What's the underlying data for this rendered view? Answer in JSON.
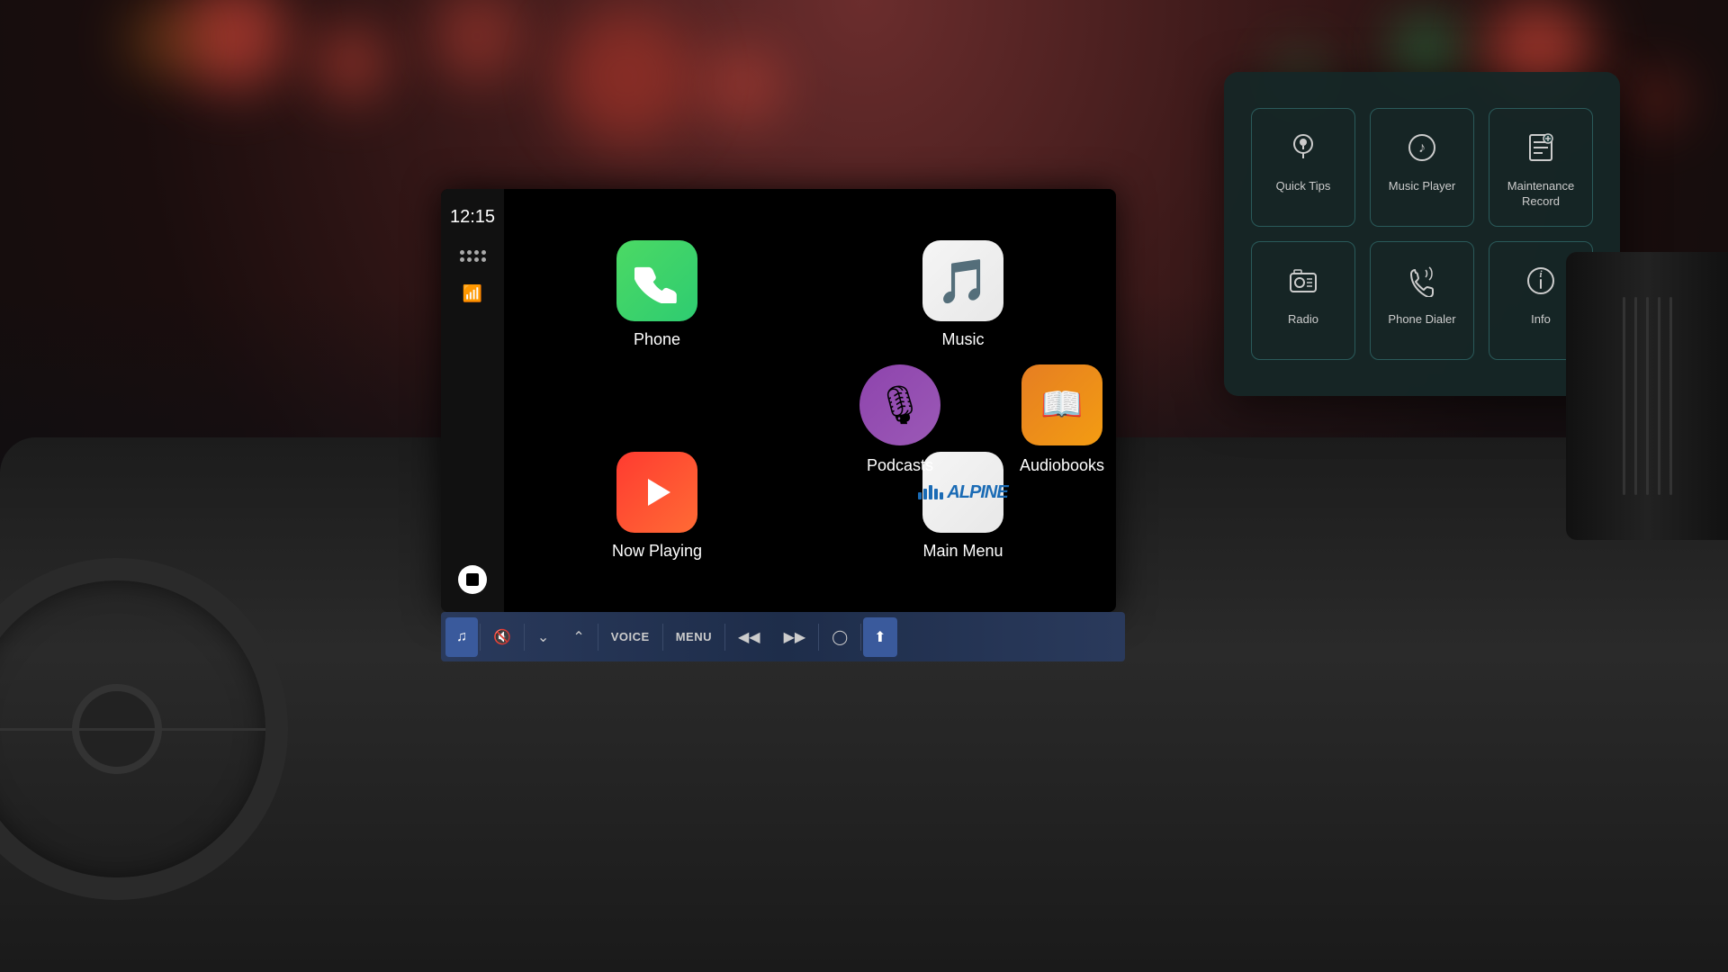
{
  "background": {
    "description": "Car interior with bokeh background"
  },
  "time": "12:15",
  "apps": {
    "phone": {
      "label": "Phone",
      "icon": "📞"
    },
    "music": {
      "label": "Music",
      "icon": "🎵"
    },
    "nowPlaying": {
      "label": "Now Playing",
      "icon": "▶"
    },
    "mainMenu": {
      "label": "Main Menu",
      "icon": "alpine"
    },
    "podcasts": {
      "label": "Podcasts",
      "icon": "🎙"
    },
    "audiobooks": {
      "label": "Audiobooks",
      "icon": "📚"
    }
  },
  "controlBar": {
    "buttons": [
      {
        "id": "music-ctrl",
        "icon": "♪",
        "active": true
      },
      {
        "id": "mute",
        "icon": "🔇",
        "active": false
      },
      {
        "id": "down",
        "icon": "∨",
        "active": false
      },
      {
        "id": "up",
        "icon": "∧",
        "active": false
      },
      {
        "id": "voice",
        "label": "VOICE",
        "active": false
      },
      {
        "id": "menu",
        "label": "MENU",
        "active": false
      },
      {
        "id": "prev",
        "icon": "⏮",
        "active": false
      },
      {
        "id": "next",
        "icon": "⏭",
        "active": false
      },
      {
        "id": "power",
        "icon": "○",
        "active": false
      },
      {
        "id": "nav",
        "icon": "⬆",
        "active": true
      }
    ]
  },
  "popup": {
    "items": [
      {
        "id": "quick-tips",
        "label": "Quick Tips",
        "icon": "💡"
      },
      {
        "id": "music-player",
        "label": "Music Player",
        "icon": "♪"
      },
      {
        "id": "maintenance-record",
        "label": "Maintenance Record",
        "icon": "⚙"
      },
      {
        "id": "radio",
        "label": "Radio",
        "icon": "📻"
      },
      {
        "id": "phone-dialer",
        "label": "Phone Dialer",
        "icon": "📞"
      },
      {
        "id": "info",
        "label": "Info",
        "icon": "ℹ"
      }
    ]
  }
}
